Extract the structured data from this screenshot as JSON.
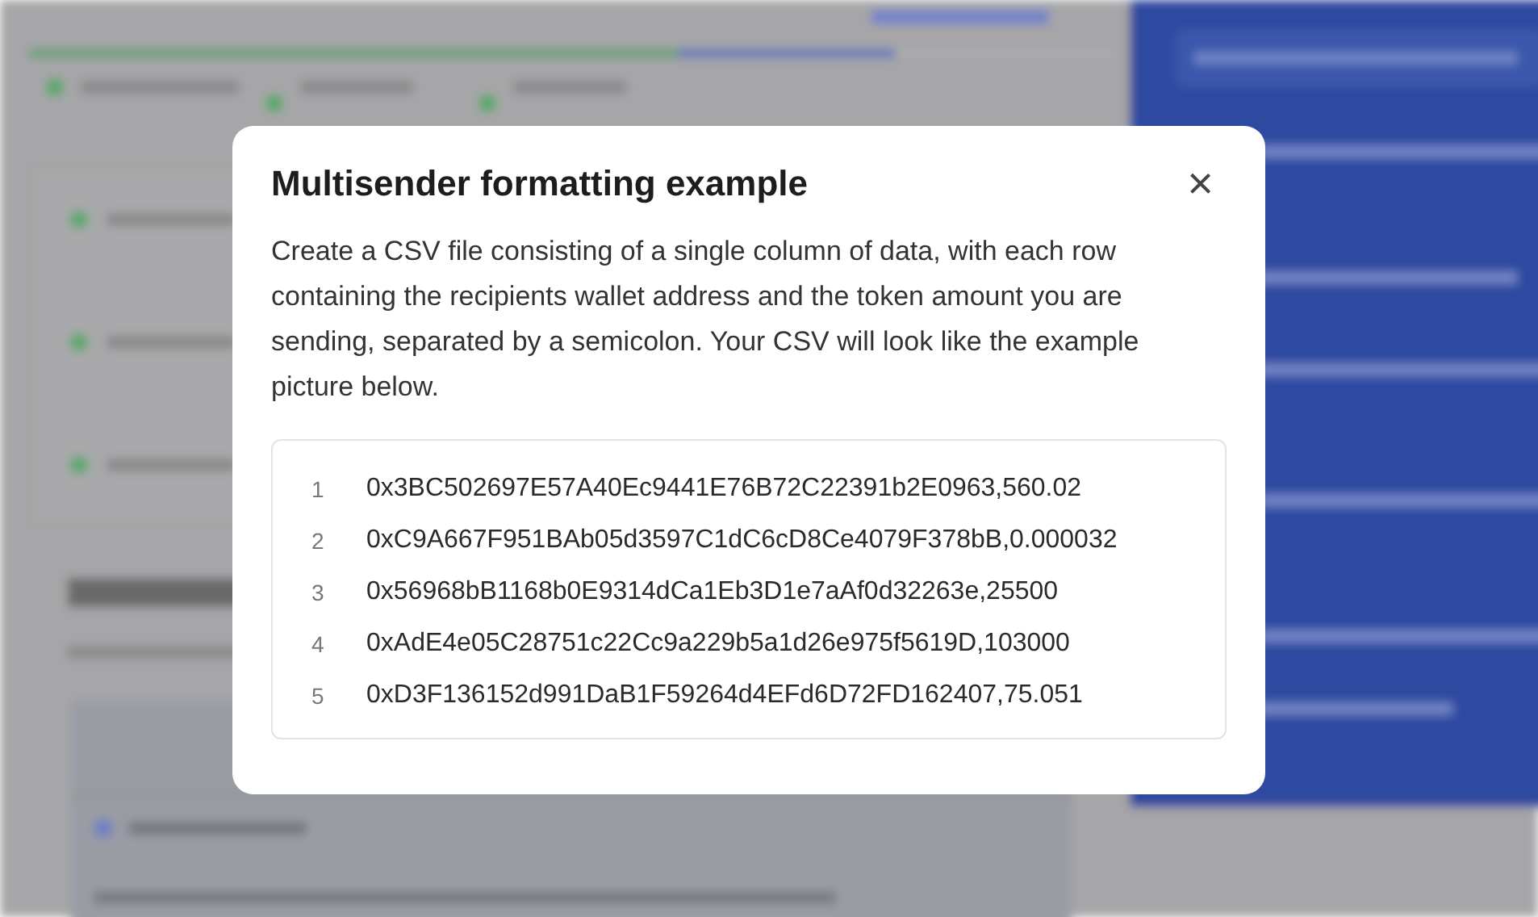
{
  "modal": {
    "title": "Multisender formatting example",
    "close_icon": "×",
    "description": "Create a CSV file consisting of a single column of data, with each row containing the recipients wallet address and the token amount you are sending, separated by a semicolon. Your CSV will look like the example picture below.",
    "example_lines": [
      {
        "number": "1",
        "text": "0x3BC502697E57A40Ec9441E76B72C22391b2E0963,560.02"
      },
      {
        "number": "2",
        "text": "0xC9A667F951BAb05d3597C1dC6cD8Ce4079F378bB,0.000032"
      },
      {
        "number": "3",
        "text": "0x56968bB1168b0E9314dCa1Eb3D1e7aAf0d32263e,25500"
      },
      {
        "number": "4",
        "text": "0xAdE4e05C28751c22Cc9a229b5a1d26e975f5619D,103000"
      },
      {
        "number": "5",
        "text": "0xD3F136152d991DaB1F59264d4EFd6D72FD162407,75.051"
      }
    ]
  }
}
